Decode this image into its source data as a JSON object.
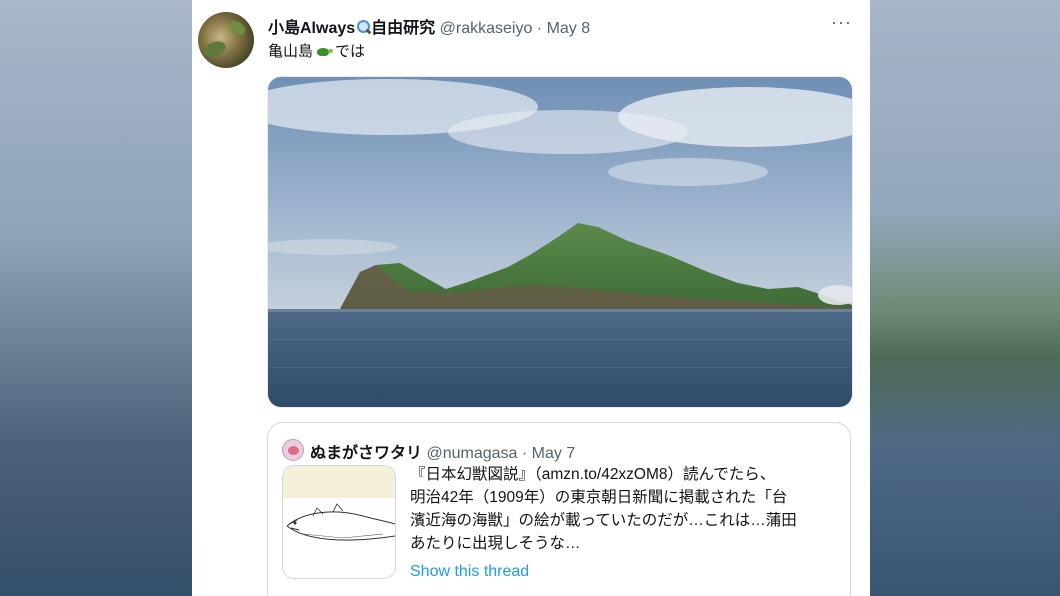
{
  "tweet": {
    "display_name": "小島Always",
    "display_name_suffix": "自由研究",
    "handle": "@rakkaseiyo",
    "separator": "·",
    "date": "May 8",
    "more_label": "···",
    "text_before": "亀山島",
    "text_after": "では",
    "icons": [
      "magnifying-glass-icon",
      "turtle-icon",
      "more-icon"
    ]
  },
  "quoted": {
    "display_name": "ぬまがさワタリ",
    "handle": "@numagasa",
    "separator": "·",
    "date": "May 7",
    "lines": [
      "『日本幻獣図説』（amzn.to/42xzOM8）読んでたら、",
      "明治42年（1909年）の東京朝日新聞に掲載された「台",
      "濱近海の海獣」の絵が載っていたのだが…これは…蒲田",
      "あたりに出現しそうな…"
    ],
    "thread_link": "Show this thread"
  },
  "colors": {
    "text_primary": "#0f1419",
    "text_secondary": "#536471",
    "link": "#1d9bf0",
    "border": "#cfd9de"
  }
}
